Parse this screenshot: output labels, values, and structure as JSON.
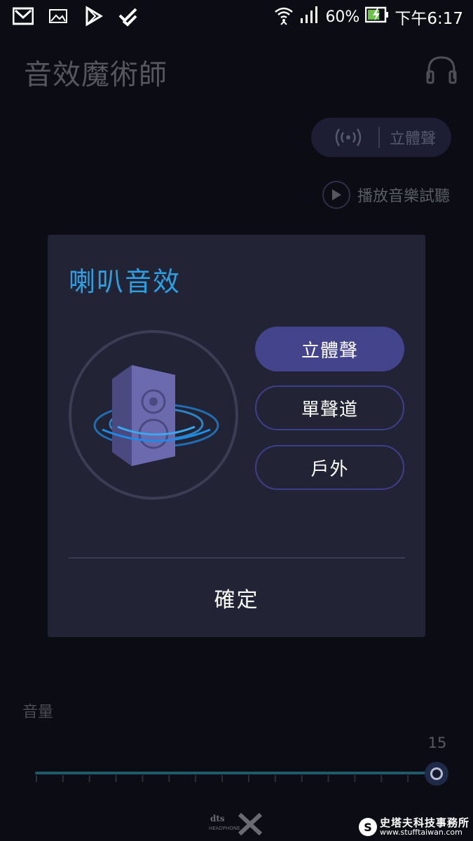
{
  "status_bar": {
    "left_icons": [
      "gmail-icon",
      "gallery-icon",
      "play-store-icon",
      "feedly-icon"
    ],
    "wifi_icon": "wifi-icon",
    "signal_icon": "signal-icon",
    "battery_percent": "60%",
    "battery_icon": "battery-charging-icon",
    "time": "下午6:17"
  },
  "app": {
    "title": "音效魔術師",
    "headphone_icon": "headphone-icon",
    "mode_pill": {
      "icon": "surround-wave-icon",
      "label": "立體聲"
    },
    "preview": {
      "icon": "play-icon",
      "label": "播放音樂試聽"
    },
    "volume": {
      "label": "音量",
      "value": "15",
      "level": 15,
      "max": 15
    },
    "logo": "dts-headphone-x-logo"
  },
  "dialog": {
    "title": "喇叭音效",
    "illustration": "speaker-surround-icon",
    "options": [
      {
        "label": "立體聲",
        "selected": true
      },
      {
        "label": "單聲道",
        "selected": false
      },
      {
        "label": "戶外",
        "selected": false
      }
    ],
    "confirm_label": "確定"
  },
  "watermark": {
    "name": "史塔夫科技事務所",
    "url": "www.stufftaiwan.com"
  },
  "colors": {
    "background": "#0c0d14",
    "dialog_bg": "#232336",
    "title_accent": "#2c9fe0",
    "selected_option": "#44448c",
    "option_border": "#3e3f8a"
  }
}
